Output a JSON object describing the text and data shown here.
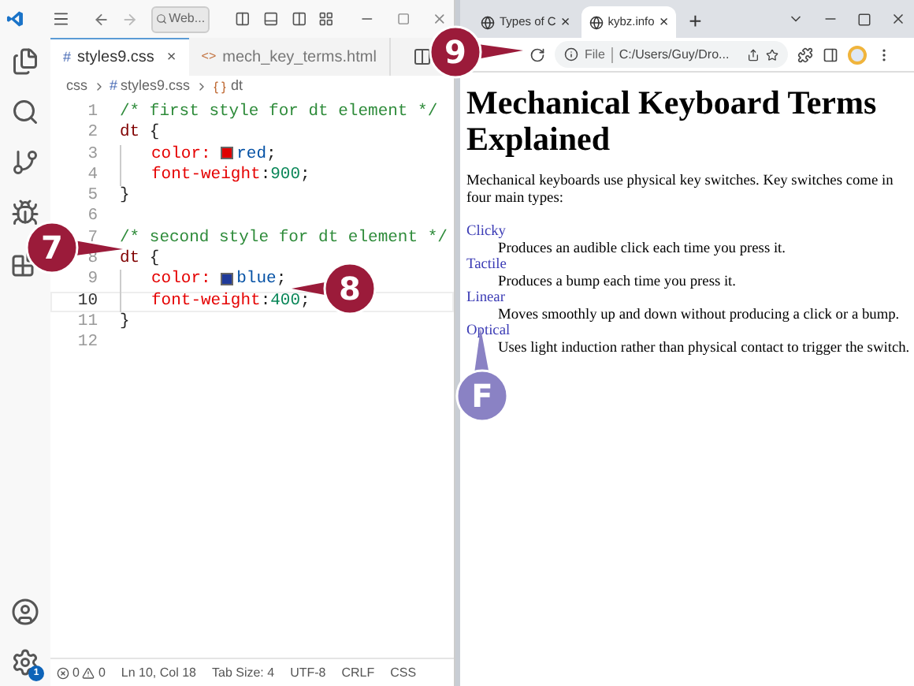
{
  "editor_window": {
    "search_placeholder": "Web...",
    "tabs": [
      {
        "icon": "#",
        "label": "styles9.css",
        "selected": true,
        "close": "×"
      },
      {
        "icon": "<>",
        "label": "mech_key_terms.html",
        "selected": false
      }
    ],
    "breadcrumb": [
      "css",
      "styles9.css",
      "dt"
    ],
    "lines": [
      {
        "number": "1",
        "indented": false,
        "selected": false,
        "tokens": [
          {
            "kind": "comment",
            "text": "/* first style for dt element */"
          }
        ]
      },
      {
        "number": "2",
        "indented": false,
        "selected": false,
        "tokens": [
          {
            "kind": "selector",
            "text": "dt"
          },
          {
            "kind": "punct",
            "text": " {"
          }
        ]
      },
      {
        "number": "3",
        "indented": true,
        "selected": false,
        "tokens": [
          {
            "kind": "property",
            "text": "color: "
          },
          {
            "kind": "swatch",
            "color": "#e00000"
          },
          {
            "kind": "value",
            "text": "red"
          },
          {
            "kind": "punct",
            "text": ";"
          }
        ]
      },
      {
        "number": "4",
        "indented": true,
        "selected": false,
        "tokens": [
          {
            "kind": "property",
            "text": "font-weight"
          },
          {
            "kind": "punct",
            "text": ":"
          },
          {
            "kind": "number",
            "text": "900"
          },
          {
            "kind": "punct",
            "text": ";"
          }
        ]
      },
      {
        "number": "5",
        "indented": false,
        "selected": false,
        "tokens": [
          {
            "kind": "punct",
            "text": "}"
          }
        ]
      },
      {
        "number": "6",
        "indented": false,
        "selected": false
      },
      {
        "number": "7",
        "indented": false,
        "selected": false,
        "tokens": [
          {
            "kind": "comment",
            "text": "/* second style for dt element */"
          }
        ]
      },
      {
        "number": "8",
        "indented": false,
        "selected": false,
        "tokens": [
          {
            "kind": "selector",
            "text": "dt"
          },
          {
            "kind": "punct",
            "text": " {"
          }
        ]
      },
      {
        "number": "9",
        "indented": true,
        "selected": false,
        "tokens": [
          {
            "kind": "property",
            "text": "color: "
          },
          {
            "kind": "swatch",
            "color": "#1f3a9a"
          },
          {
            "kind": "value",
            "text": "blue"
          },
          {
            "kind": "punct",
            "text": ";"
          }
        ]
      },
      {
        "number": "10",
        "indented": true,
        "selected": true,
        "tokens": [
          {
            "kind": "property",
            "text": "font-weight"
          },
          {
            "kind": "punct",
            "text": ":"
          },
          {
            "kind": "number",
            "text": "400"
          },
          {
            "kind": "punct",
            "text": ";"
          }
        ]
      },
      {
        "number": "11",
        "indented": false,
        "selected": false,
        "tokens": [
          {
            "kind": "punct",
            "text": "}"
          }
        ]
      },
      {
        "number": "12",
        "indented": false,
        "selected": false
      }
    ],
    "settings_badge": "1",
    "status_bar": {
      "errors": "0",
      "warnings": "0",
      "items": [
        "Ln 10, Col 18",
        "Tab Size: 4",
        "UTF-8",
        "CRLF",
        "CSS"
      ]
    }
  },
  "browser_window": {
    "tabs": [
      {
        "label": "Types of C",
        "selected": false,
        "close": "×"
      },
      {
        "label": "kybz.info",
        "selected": true,
        "close": "×"
      }
    ],
    "new_tab": "+",
    "address": {
      "scheme": "File",
      "path": "C:/Users/Guy/Dro..."
    },
    "page": {
      "heading": "Mechanical Keyboard Terms Explained",
      "intro": "Mechanical keyboards use physical key switches. Key switches come in four main types:",
      "terms": [
        {
          "term": "Clicky",
          "definition": "Produces an audible click each time you press it."
        },
        {
          "term": "Tactile",
          "definition": "Produces a bump each time you press it."
        },
        {
          "term": "Linear",
          "definition": "Moves smoothly up and down without producing a click or a bump."
        },
        {
          "term": "Optical",
          "definition": "Uses light induction rather than physical contact to trigger the switch."
        }
      ]
    }
  },
  "callouts": [
    {
      "label": "7",
      "color": "#9b1b3a"
    },
    {
      "label": "8",
      "color": "#9b1b3a"
    },
    {
      "label": "9",
      "color": "#9b1b3a"
    },
    {
      "label": "F",
      "color": "#8a82c4"
    }
  ]
}
